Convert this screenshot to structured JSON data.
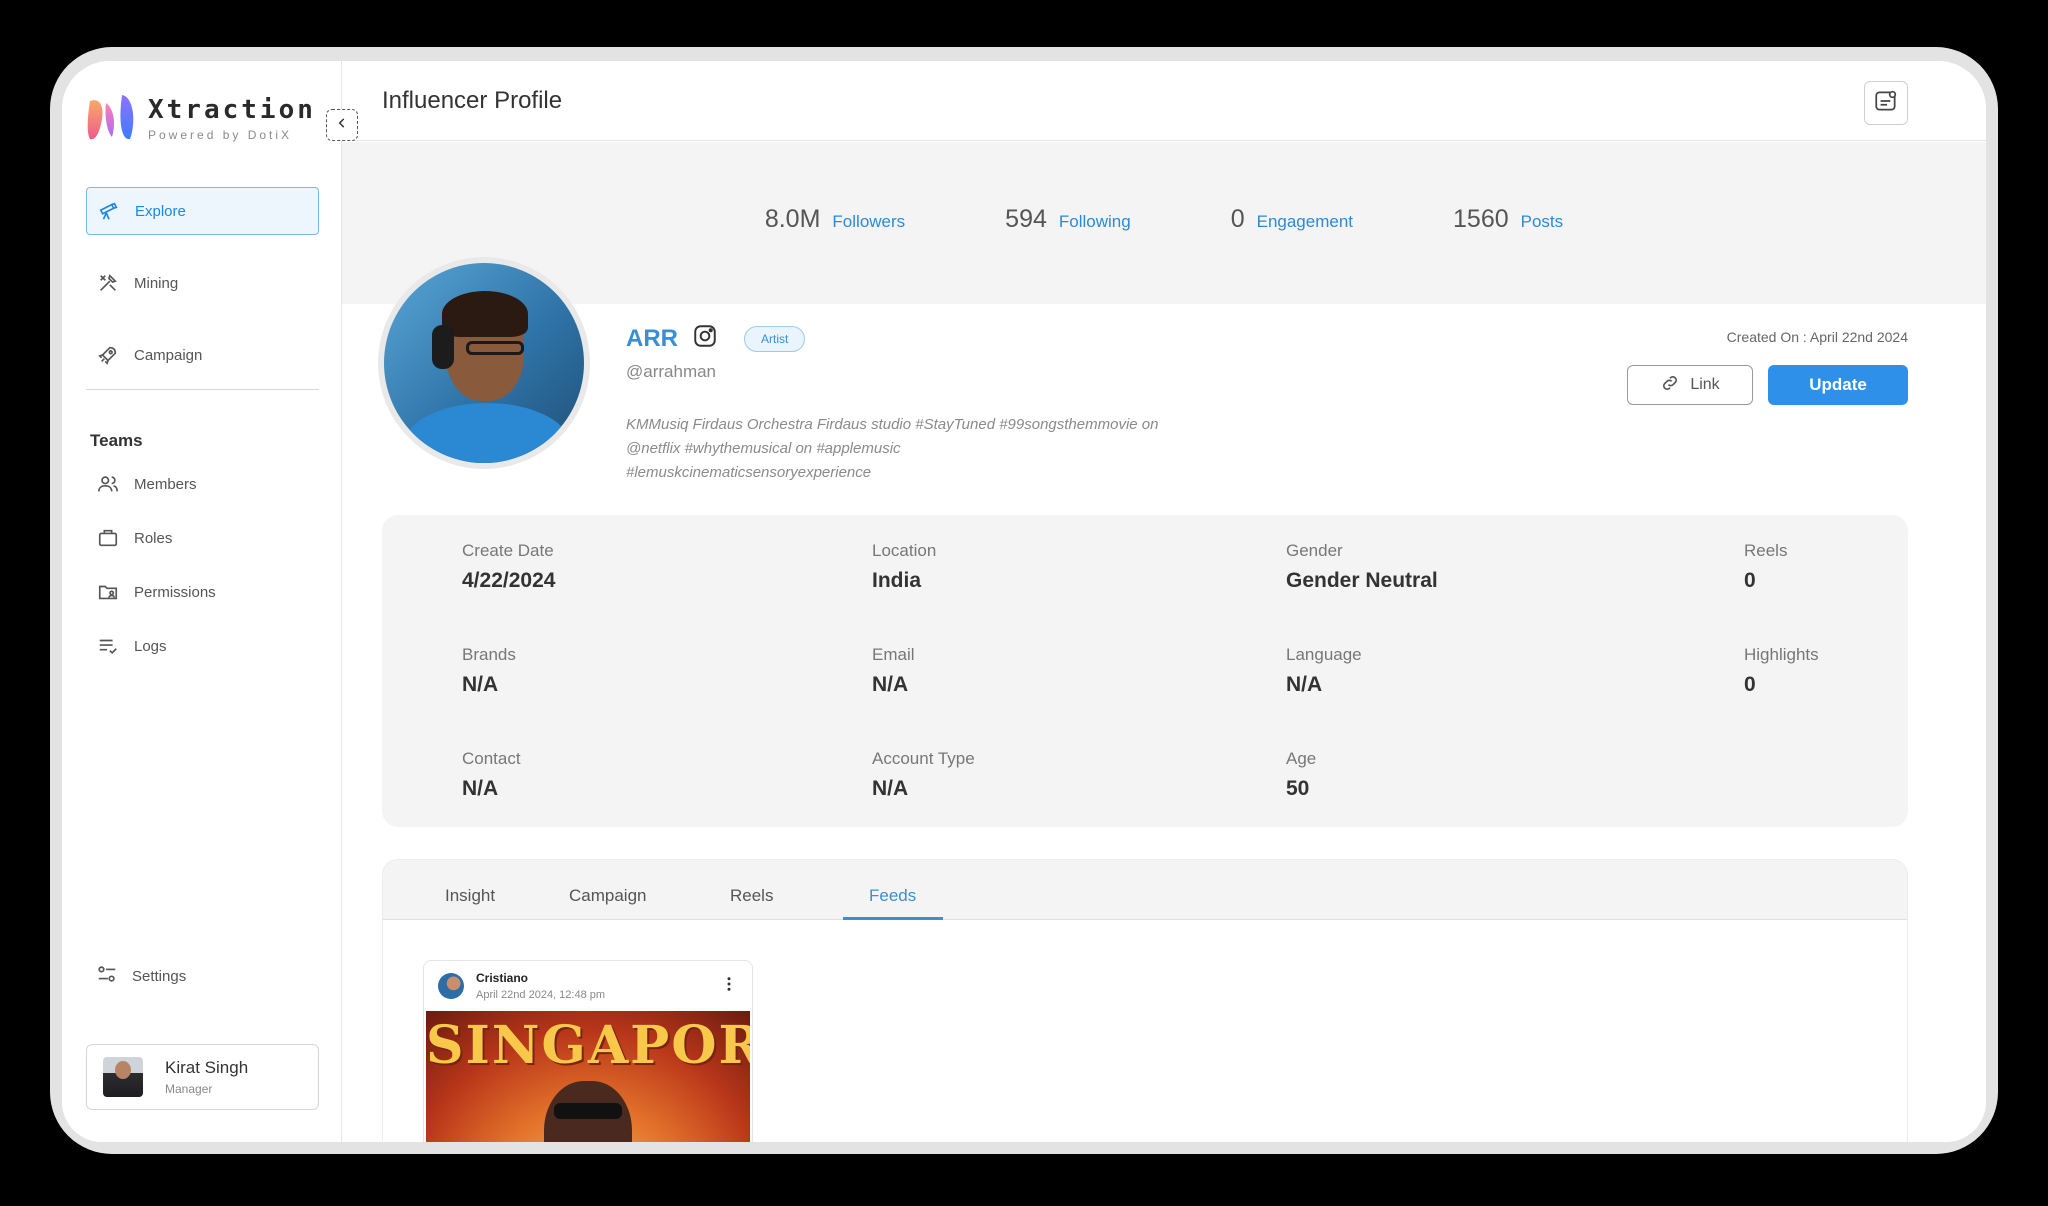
{
  "app": {
    "name": "Xtraction",
    "tagline": "Powered by DotiX"
  },
  "sidebar": {
    "nav": [
      {
        "label": "Explore",
        "icon": "telescope-icon",
        "active": true
      },
      {
        "label": "Mining",
        "icon": "tools-icon",
        "active": false
      },
      {
        "label": "Campaign",
        "icon": "rocket-icon",
        "active": false
      }
    ],
    "teams_title": "Teams",
    "teams": [
      {
        "label": "Members",
        "icon": "users-icon"
      },
      {
        "label": "Roles",
        "icon": "briefcase-icon"
      },
      {
        "label": "Permissions",
        "icon": "folder-user-icon"
      },
      {
        "label": "Logs",
        "icon": "list-check-icon"
      }
    ],
    "settings_label": "Settings",
    "user": {
      "name": "Kirat Singh",
      "role": "Manager"
    }
  },
  "header": {
    "title": "Influencer Profile"
  },
  "stats": [
    {
      "value": "8.0M",
      "label": "Followers"
    },
    {
      "value": "594",
      "label": "Following"
    },
    {
      "value": "0",
      "label": "Engagement"
    },
    {
      "value": "1560",
      "label": "Posts"
    }
  ],
  "profile": {
    "name": "ARR",
    "badge": "Artist",
    "handle": "@arrahman",
    "bio_lines": [
      "KMMusiq Firdaus Orchestra Firdaus studio #StayTuned #99songsthemmovie on",
      "@netflix #whythemusical on #applemusic",
      "#lemuskcinematicsensoryexperience"
    ],
    "created_on": "Created On : April 22nd 2024",
    "link_label": "Link",
    "update_label": "Update"
  },
  "details": {
    "create_date": {
      "label": "Create Date",
      "value": "4/22/2024"
    },
    "location": {
      "label": "Location",
      "value": "India"
    },
    "gender": {
      "label": "Gender",
      "value": "Gender Neutral"
    },
    "reels": {
      "label": "Reels",
      "value": "0"
    },
    "brands": {
      "label": "Brands",
      "value": "N/A"
    },
    "email": {
      "label": "Email",
      "value": "N/A"
    },
    "language": {
      "label": "Language",
      "value": "N/A"
    },
    "highlights": {
      "label": "Highlights",
      "value": "0"
    },
    "contact": {
      "label": "Contact",
      "value": "N/A"
    },
    "account_type": {
      "label": "Account Type",
      "value": "N/A"
    },
    "age": {
      "label": "Age",
      "value": "50"
    }
  },
  "tabs": [
    {
      "label": "Insight",
      "active": false
    },
    {
      "label": "Campaign",
      "active": false
    },
    {
      "label": "Reels",
      "active": false
    },
    {
      "label": "Feeds",
      "active": true
    }
  ],
  "feed": {
    "author": "Cristiano",
    "date": "April 22nd 2024, 12:48 pm",
    "image_text": "SINGAPORE"
  },
  "colors": {
    "accent": "#2e90e8",
    "link_blue": "#3a8fd4",
    "panel_bg": "#f4f4f4"
  }
}
